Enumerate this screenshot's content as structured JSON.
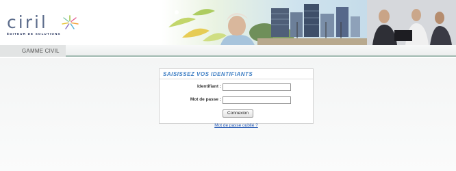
{
  "header": {
    "logo": {
      "word": "ciril",
      "tagline": "ÉDITEUR DE SOLUTIONS"
    }
  },
  "nav": {
    "tab_label": "GAMME CIVIL"
  },
  "login": {
    "title": "SAISISSEZ VOS IDENTIFIANTS",
    "username_label": "Identifiant :",
    "username_value": "",
    "password_label": "Mot de passe :",
    "password_value": "",
    "submit_label": "Connexion",
    "forgot_link": "Mot de passe oublié ?"
  },
  "colors": {
    "title_blue": "#3f7fc4",
    "link_blue": "#2458b3",
    "logo_slate": "#5d6d8c",
    "nav_rule": "#9fb9b0"
  }
}
